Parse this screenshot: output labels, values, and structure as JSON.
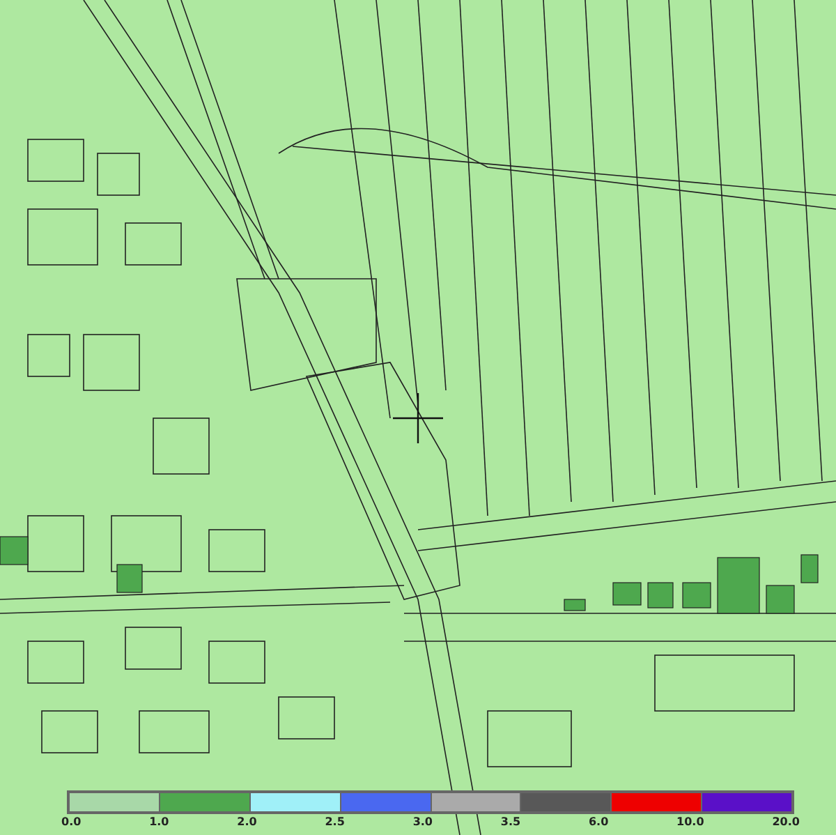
{
  "legend": {
    "segments": [
      {
        "color": "#a8d8a8"
      },
      {
        "color": "#4ea84e"
      },
      {
        "color": "#a0f0f8"
      },
      {
        "color": "#4a68f0"
      },
      {
        "color": "#aaaaaa"
      },
      {
        "color": "#585858"
      },
      {
        "color": "#ee0000"
      },
      {
        "color": "#5a10c8"
      }
    ],
    "labels": [
      "0.0",
      "1.0",
      "2.0",
      "2.5",
      "3.0",
      "3.5",
      "6.0",
      "10.0",
      "20.0"
    ]
  }
}
